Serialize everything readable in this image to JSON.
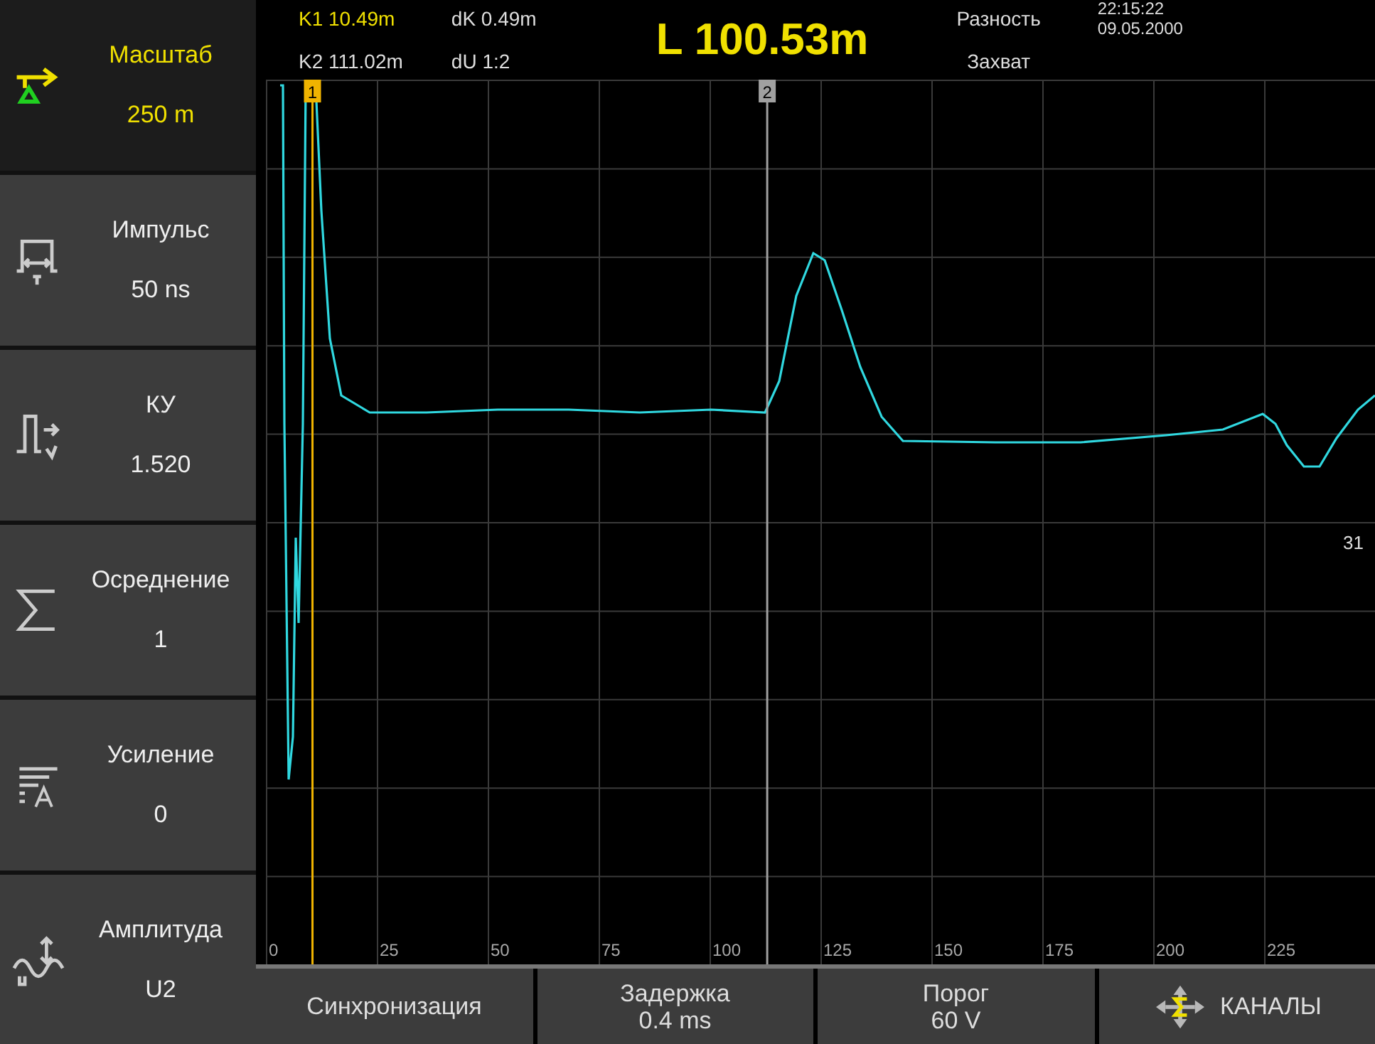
{
  "sidebar": {
    "items": [
      {
        "label": "Масштаб",
        "value": "250 m",
        "selected": true
      },
      {
        "label": "Импульс",
        "value": "50 ns",
        "selected": false
      },
      {
        "label": "КУ",
        "value": "1.520",
        "selected": false
      },
      {
        "label": "Осреднение",
        "value": "1",
        "selected": false
      },
      {
        "label": "Усиление",
        "value": "0",
        "selected": false
      },
      {
        "label": "Амплитуда",
        "value": "U2",
        "selected": false
      }
    ]
  },
  "header": {
    "k1": "K1 10.49m",
    "k2": "K2 111.02m",
    "dk": "dK 0.49m",
    "du": "dU 1:2",
    "distance": "L 100.53m",
    "mode_1": "Разность",
    "mode_2": "Захват",
    "time": "22:15:22",
    "date": "09.05.2000"
  },
  "plot": {
    "cursors": [
      {
        "label": "1",
        "level": 0.042,
        "color": "#f0b400"
      },
      {
        "label": "2",
        "level": 0.452,
        "color": "#a0a0a0"
      }
    ],
    "side_label": "31",
    "x_labels": [
      "0",
      "25",
      "50",
      "75",
      "100",
      "125",
      "150",
      "175",
      "200",
      "225"
    ]
  },
  "bottom_bar": [
    {
      "label": "Синхронизация",
      "kind": "setting"
    },
    {
      "label": "Задержка",
      "value": "0.4 ms",
      "kind": "setting"
    },
    {
      "label": "Порог",
      "value": "60 V",
      "kind": "setting"
    },
    {
      "label": "КАНАЛЫ",
      "kind": "channels"
    }
  ]
}
